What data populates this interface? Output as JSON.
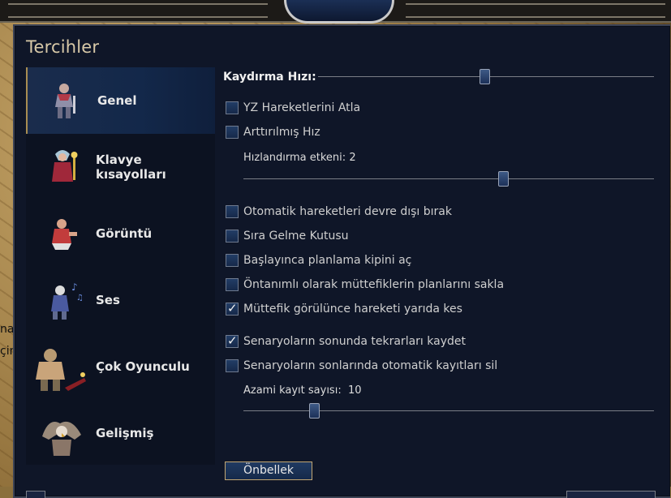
{
  "dialog": {
    "title": "Tercihler"
  },
  "background_text": {
    "line1": "nad",
    "line2": "çin"
  },
  "sidebar": {
    "items": [
      {
        "label": "Genel",
        "active": true,
        "icon": "knight-sprite-icon"
      },
      {
        "label": "Klavye kısayolları",
        "active": false,
        "icon": "mage-sprite-icon"
      },
      {
        "label": "Görüntü",
        "active": false,
        "icon": "fighter-sprite-icon"
      },
      {
        "label": "Ses",
        "active": false,
        "icon": "bard-sprite-icon"
      },
      {
        "label": "Çok Oyunculu",
        "active": false,
        "icon": "ogre-sprite-icon"
      },
      {
        "label": "Gelişmiş",
        "active": false,
        "icon": "gryphon-sprite-icon"
      }
    ]
  },
  "general": {
    "scroll_speed": {
      "label": "Kaydırma Hızı:",
      "value_fraction": 0.6
    },
    "skip_ai_moves": {
      "label": "YZ Hareketlerini Atla",
      "checked": false
    },
    "accelerated_speed": {
      "label": "Arttırılmış Hız",
      "checked": false
    },
    "acceleration_factor": {
      "label": "Hızlandırma etkeni:",
      "value": "2",
      "value_fraction": 0.63
    },
    "disable_auto_moves": {
      "label": "Otomatik hareketleri devre dışı bırak",
      "checked": false
    },
    "turn_dialog": {
      "label": "Sıra Gelme Kutusu",
      "checked": false
    },
    "start_planning_mode": {
      "label": "Başlayınca planlama kipini aç",
      "checked": false
    },
    "hide_ally_plans": {
      "label": "Öntanımlı olarak müttefiklerin planlarını sakla",
      "checked": false
    },
    "interrupt_on_ally": {
      "label": "Müttefik görülünce hareketi yarıda kes",
      "checked": true
    },
    "save_replays": {
      "label": "Senaryoların sonunda tekrarları kaydet",
      "checked": true
    },
    "delete_autosaves": {
      "label": "Senaryoların sonlarında otomatik kayıtları sil",
      "checked": false
    },
    "max_saves": {
      "label": "Azami kayıt sayısı:",
      "value": "10",
      "value_fraction": 0.17
    },
    "cache_button": {
      "label": "Önbellek"
    }
  },
  "colors": {
    "dialog_bg": "#0f1628",
    "active_item_bg": "#13284a",
    "accent_gold": "#c2a672"
  }
}
